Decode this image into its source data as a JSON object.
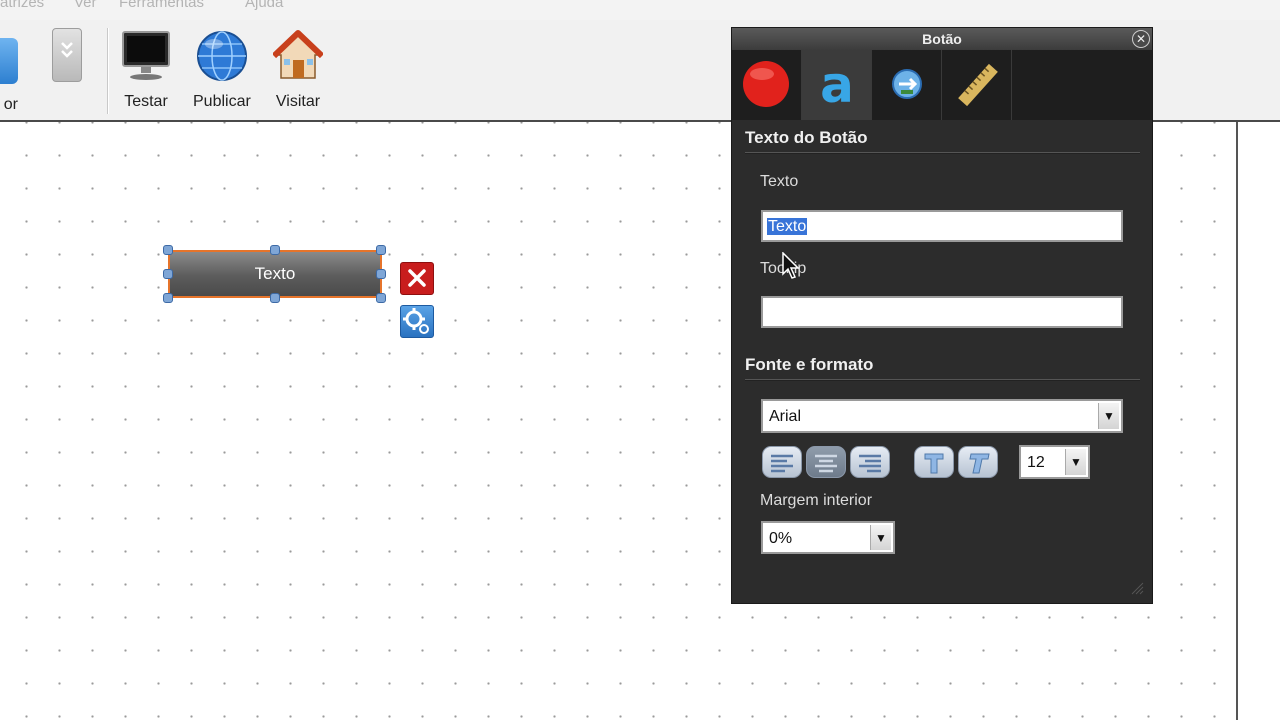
{
  "menu": {
    "items": [
      "atrizes",
      "Ver",
      "Ferramentas",
      "Ajuda"
    ]
  },
  "toolbar": {
    "partial_label": "or",
    "tools": [
      {
        "label": "Testar",
        "icon": "monitor-icon"
      },
      {
        "label": "Publicar",
        "icon": "globe-icon"
      },
      {
        "label": "Visitar",
        "icon": "home-icon"
      }
    ]
  },
  "canvas": {
    "widget_text": "Texto"
  },
  "panel": {
    "title": "Botão",
    "tabs": [
      {
        "icon": "record-icon"
      },
      {
        "icon": "text-style-icon",
        "active": true
      },
      {
        "icon": "link-icon"
      },
      {
        "icon": "ruler-icon"
      }
    ],
    "section_text": "Texto do Botão",
    "texto_label": "Texto",
    "texto_value": "Texto",
    "tooltip_label": "Tooltip",
    "tooltip_value": "",
    "section_font": "Fonte e formato",
    "font_value": "Arial",
    "font_size": "12",
    "margin_label": "Margem interior",
    "margin_value": "0%"
  },
  "colors": {
    "accent_selection": "#3874d8",
    "widget_border": "#e6742b",
    "panel_bg": "#2c2c2c"
  }
}
